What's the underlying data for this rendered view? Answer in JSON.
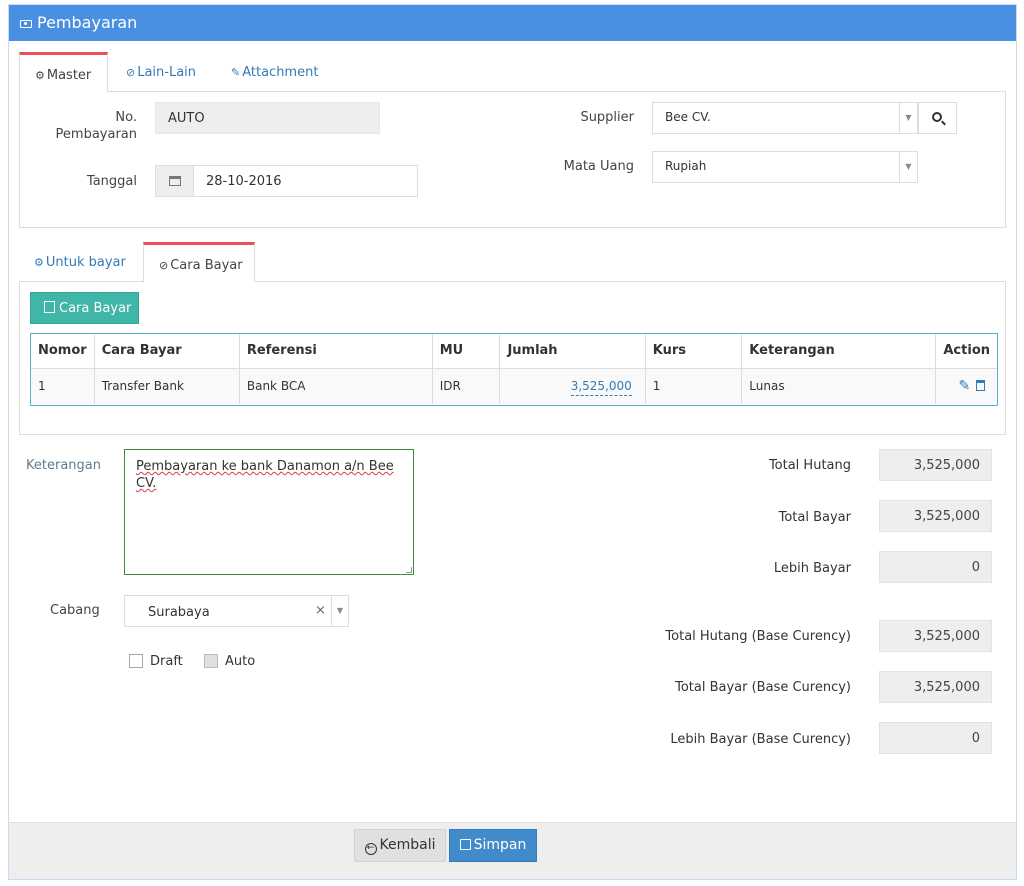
{
  "header": {
    "title": "Pembayaran"
  },
  "top_tabs": [
    {
      "label": "Master",
      "icon": "gears-icon"
    },
    {
      "label": "Lain-Lain",
      "icon": "check-circle-icon"
    },
    {
      "label": "Attachment",
      "icon": "paperclip-icon"
    }
  ],
  "form": {
    "no_label": "No. Pembayaran",
    "no_line1": "No.",
    "no_line2": "Pembayaran",
    "no_value": "AUTO",
    "tanggal_label": "Tanggal",
    "tanggal_value": "28-10-2016",
    "supplier_label": "Supplier",
    "supplier_value": "Bee CV.",
    "mata_uang_label": "Mata Uang",
    "mata_uang_value": "Rupiah"
  },
  "sub_tabs": [
    {
      "label": "Untuk bayar",
      "icon": "gears-icon"
    },
    {
      "label": "Cara Bayar",
      "icon": "check-circle-icon"
    }
  ],
  "cara_bayar_button": "Cara Bayar",
  "table": {
    "columns": [
      "Nomor",
      "Cara Bayar",
      "Referensi",
      "MU",
      "Jumlah",
      "Kurs",
      "Keterangan",
      "Action"
    ],
    "rows": [
      {
        "nomor": "1",
        "cara_bayar": "Transfer Bank",
        "referensi": "Bank BCA",
        "mu": "IDR",
        "jumlah": "3,525,000",
        "kurs": "1",
        "keterangan": "Lunas"
      }
    ]
  },
  "keterangan": {
    "label": "Keterangan",
    "value": "Pembayaran ke bank Danamon a/n Bee CV."
  },
  "cabang": {
    "label": "Cabang",
    "value": "Surabaya"
  },
  "checkboxes": {
    "draft": "Draft",
    "auto": "Auto"
  },
  "totals": [
    {
      "label": "Total Hutang",
      "value": "3,525,000"
    },
    {
      "label": "Total Bayar",
      "value": "3,525,000"
    },
    {
      "label": "Lebih Bayar",
      "value": "0"
    },
    {
      "label": "Total Hutang (Base Curency)",
      "value": "3,525,000"
    },
    {
      "label": "Total Bayar (Base Curency)",
      "value": "3,525,000"
    },
    {
      "label": "Lebih Bayar (Base Curency)",
      "value": "0"
    }
  ],
  "footer": {
    "kembali": "Kembali",
    "simpan": "Simpan"
  },
  "colors": {
    "header": "#4a90e2",
    "teal": "#3fb6a8",
    "tab_accent": "#e8505b",
    "primary": "#428bca"
  }
}
